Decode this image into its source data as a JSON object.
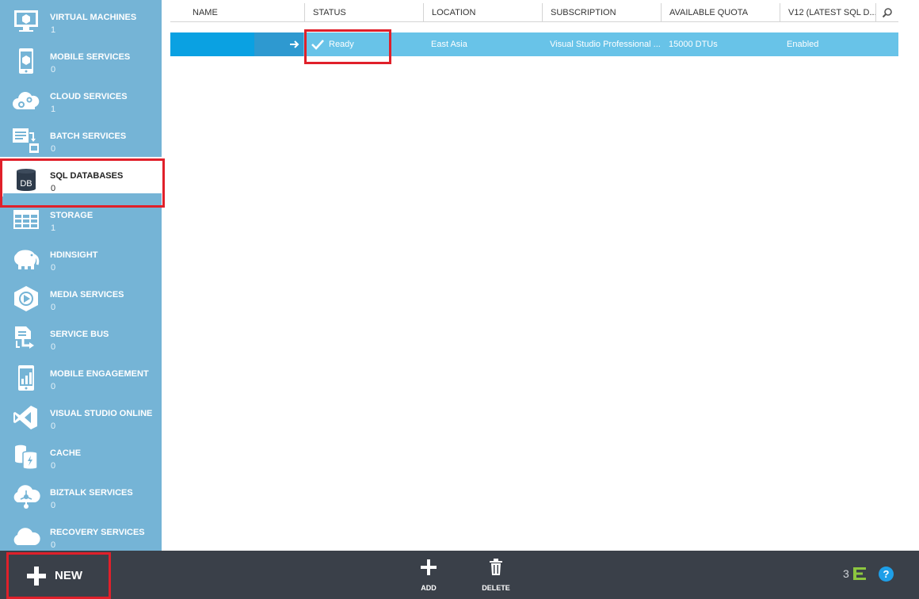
{
  "sidebar": {
    "items": [
      {
        "label": "VIRTUAL MACHINES",
        "count": "1",
        "icon": "monitor-icon"
      },
      {
        "label": "MOBILE SERVICES",
        "count": "0",
        "icon": "mobile-icon"
      },
      {
        "label": "CLOUD SERVICES",
        "count": "1",
        "icon": "cloud-gear-icon"
      },
      {
        "label": "BATCH SERVICES",
        "count": "0",
        "icon": "batch-icon"
      },
      {
        "label": "SQL DATABASES",
        "count": "0",
        "icon": "database-icon",
        "icon_text": "DB"
      },
      {
        "label": "STORAGE",
        "count": "1",
        "icon": "table-grid-icon"
      },
      {
        "label": "HDINSIGHT",
        "count": "0",
        "icon": "elephant-icon"
      },
      {
        "label": "MEDIA SERVICES",
        "count": "0",
        "icon": "play-hex-icon"
      },
      {
        "label": "SERVICE BUS",
        "count": "0",
        "icon": "service-bus-icon"
      },
      {
        "label": "MOBILE ENGAGEMENT",
        "count": "0",
        "icon": "mobile-chart-icon"
      },
      {
        "label": "VISUAL STUDIO ONLINE",
        "count": "0",
        "icon": "visual-studio-icon"
      },
      {
        "label": "CACHE",
        "count": "0",
        "icon": "cache-icon"
      },
      {
        "label": "BIZTALK SERVICES",
        "count": "0",
        "icon": "biztalk-icon"
      },
      {
        "label": "RECOVERY SERVICES",
        "count": "0",
        "icon": "recovery-cloud-icon"
      }
    ]
  },
  "grid": {
    "columns": [
      "NAME",
      "STATUS",
      "LOCATION",
      "SUBSCRIPTION",
      "AVAILABLE QUOTA",
      "V12 (LATEST SQL D..."
    ],
    "rows": [
      {
        "name": "",
        "status": "Ready",
        "location": "East Asia",
        "subscription": "Visual Studio Professional ...",
        "quota": "15000 DTUs",
        "v12": "Enabled"
      }
    ]
  },
  "bottom_bar": {
    "new_label": "NEW",
    "add_label": "ADD",
    "delete_label": "DELETE",
    "notification_count": "3",
    "help_label": "?"
  },
  "colors": {
    "sidebar": "#75b4d6",
    "row_selected": "#68c3e8",
    "highlight": "#e0202a",
    "bottom_bar": "#3a4049",
    "help": "#1e9fe8",
    "notification": "#8cc63f"
  }
}
